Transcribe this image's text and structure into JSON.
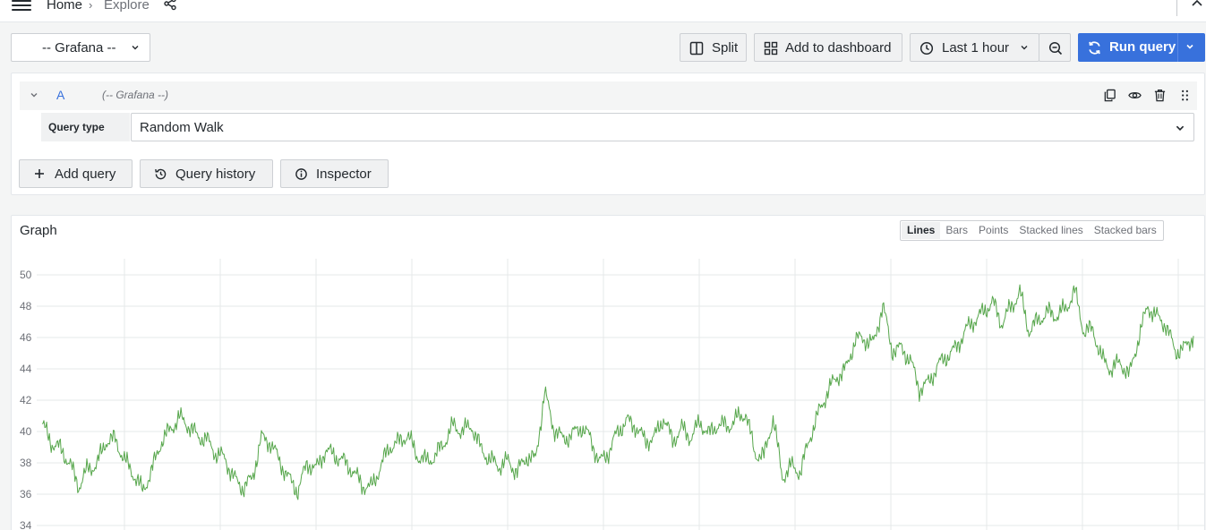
{
  "breadcrumb": {
    "home": "Home",
    "separator": "›",
    "current": "Explore"
  },
  "toolbar": {
    "datasource": "-- Grafana --",
    "split": "Split",
    "add_to_dashboard": "Add to dashboard",
    "time_range": "Last 1 hour",
    "run_query": "Run query"
  },
  "query": {
    "ref_id": "A",
    "datasource": "(-- Grafana --)",
    "query_type_label": "Query type",
    "query_type_value": "Random Walk"
  },
  "actions": {
    "add_query": "Add query",
    "query_history": "Query history",
    "inspector": "Inspector"
  },
  "graph": {
    "title": "Graph",
    "modes": [
      "Lines",
      "Bars",
      "Points",
      "Stacked lines",
      "Stacked bars"
    ],
    "active_mode": "Lines"
  },
  "colors": {
    "accent": "#3871dc",
    "series": "#56a64b"
  },
  "chart_data": {
    "type": "line",
    "title": "",
    "xlabel": "",
    "ylabel": "",
    "ylim": [
      34,
      50
    ],
    "yticks": [
      50,
      48,
      46,
      44,
      42,
      40,
      38,
      36,
      34
    ],
    "grid": true,
    "series": [
      {
        "values": [
          40.5,
          39.3,
          38.9,
          38.0,
          36.5,
          37.6,
          37.9,
          39.4,
          39.5,
          38.2,
          37.3,
          36.2,
          37.5,
          39.3,
          40.1,
          40.9,
          40.4,
          39.7,
          39.5,
          38.6,
          38.3,
          37.0,
          36.4,
          37.0,
          39.6,
          39.3,
          38.1,
          37.0,
          36.2,
          38.0,
          37.6,
          38.8,
          38.5,
          38.1,
          37.5,
          36.6,
          36.4,
          37.7,
          39.0,
          39.3,
          39.8,
          38.5,
          38.1,
          38.4,
          39.3,
          40.4,
          40.0,
          40.4,
          38.9,
          38.2,
          37.8,
          38.1,
          37.4,
          38.4,
          38.2,
          42.5,
          40.2,
          39.5,
          39.8,
          40.3,
          39.6,
          38.0,
          38.7,
          40.0,
          40.7,
          40.3,
          39.4,
          39.6,
          40.9,
          39.4,
          40.2,
          39.6,
          40.6,
          39.8,
          40.5,
          40.3,
          40.8,
          41.2,
          38.6,
          38.4,
          40.9,
          37.1,
          37.8,
          37.4,
          39.6,
          41.2,
          42.6,
          43.5,
          44.0,
          45.9,
          45.9,
          45.6,
          48.1,
          45.2,
          45.3,
          44.6,
          42.7,
          43.1,
          44.2,
          44.8,
          45.3,
          46.4,
          47.1,
          47.6,
          48.3,
          46.9,
          47.9,
          48.9,
          46.4,
          47.1,
          47.6,
          47.4,
          47.8,
          49.0,
          46.4,
          46.5,
          44.6,
          44.0,
          44.4,
          43.6,
          46.0,
          48.0,
          47.3,
          46.8,
          45.1,
          45.3,
          46.1
        ]
      }
    ]
  }
}
